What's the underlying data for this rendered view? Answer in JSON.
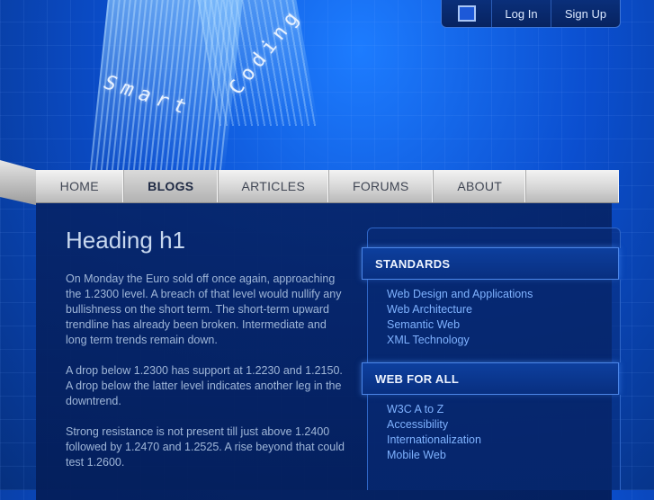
{
  "header": {
    "logo_word1": "Smart",
    "logo_word2": "Coding"
  },
  "userbar": {
    "icon": "square-icon",
    "login_label": "Log In",
    "signup_label": "Sign Up"
  },
  "nav": {
    "items": [
      {
        "label": "HOME",
        "active": false
      },
      {
        "label": "BLOGS",
        "active": true
      },
      {
        "label": "ARTICLES",
        "active": false
      },
      {
        "label": "FORUMS",
        "active": false
      },
      {
        "label": "ABOUT",
        "active": false
      }
    ]
  },
  "main": {
    "heading": "Heading h1",
    "paragraphs": [
      "On Monday the Euro sold off once again, approaching the 1.2300 level. A breach of that level would nullify any bullishness on the short term. The short-term upward trendline has already been broken. Intermediate and long term trends remain down.",
      "A drop below 1.2300 has support at 1.2230 and 1.2150. A drop below the latter level indicates another leg in the downtrend.",
      "Strong resistance is not present till just above 1.2400 followed by 1.2470 and 1.2525. A rise beyond that could test 1.2600."
    ]
  },
  "sidebar": {
    "sections": [
      {
        "title": "STANDARDS",
        "links": [
          "Web Design and Applications",
          "Web Architecture",
          "Semantic Web",
          "XML Technology"
        ]
      },
      {
        "title": "WEB FOR ALL",
        "links": [
          "W3C A to Z",
          "Accessibility",
          "Internationalization",
          "Mobile Web"
        ]
      }
    ]
  },
  "colors": {
    "background": "#0b4fd0",
    "panel": "#062468",
    "link": "#7fb2ff",
    "nav_text": "#404654"
  }
}
